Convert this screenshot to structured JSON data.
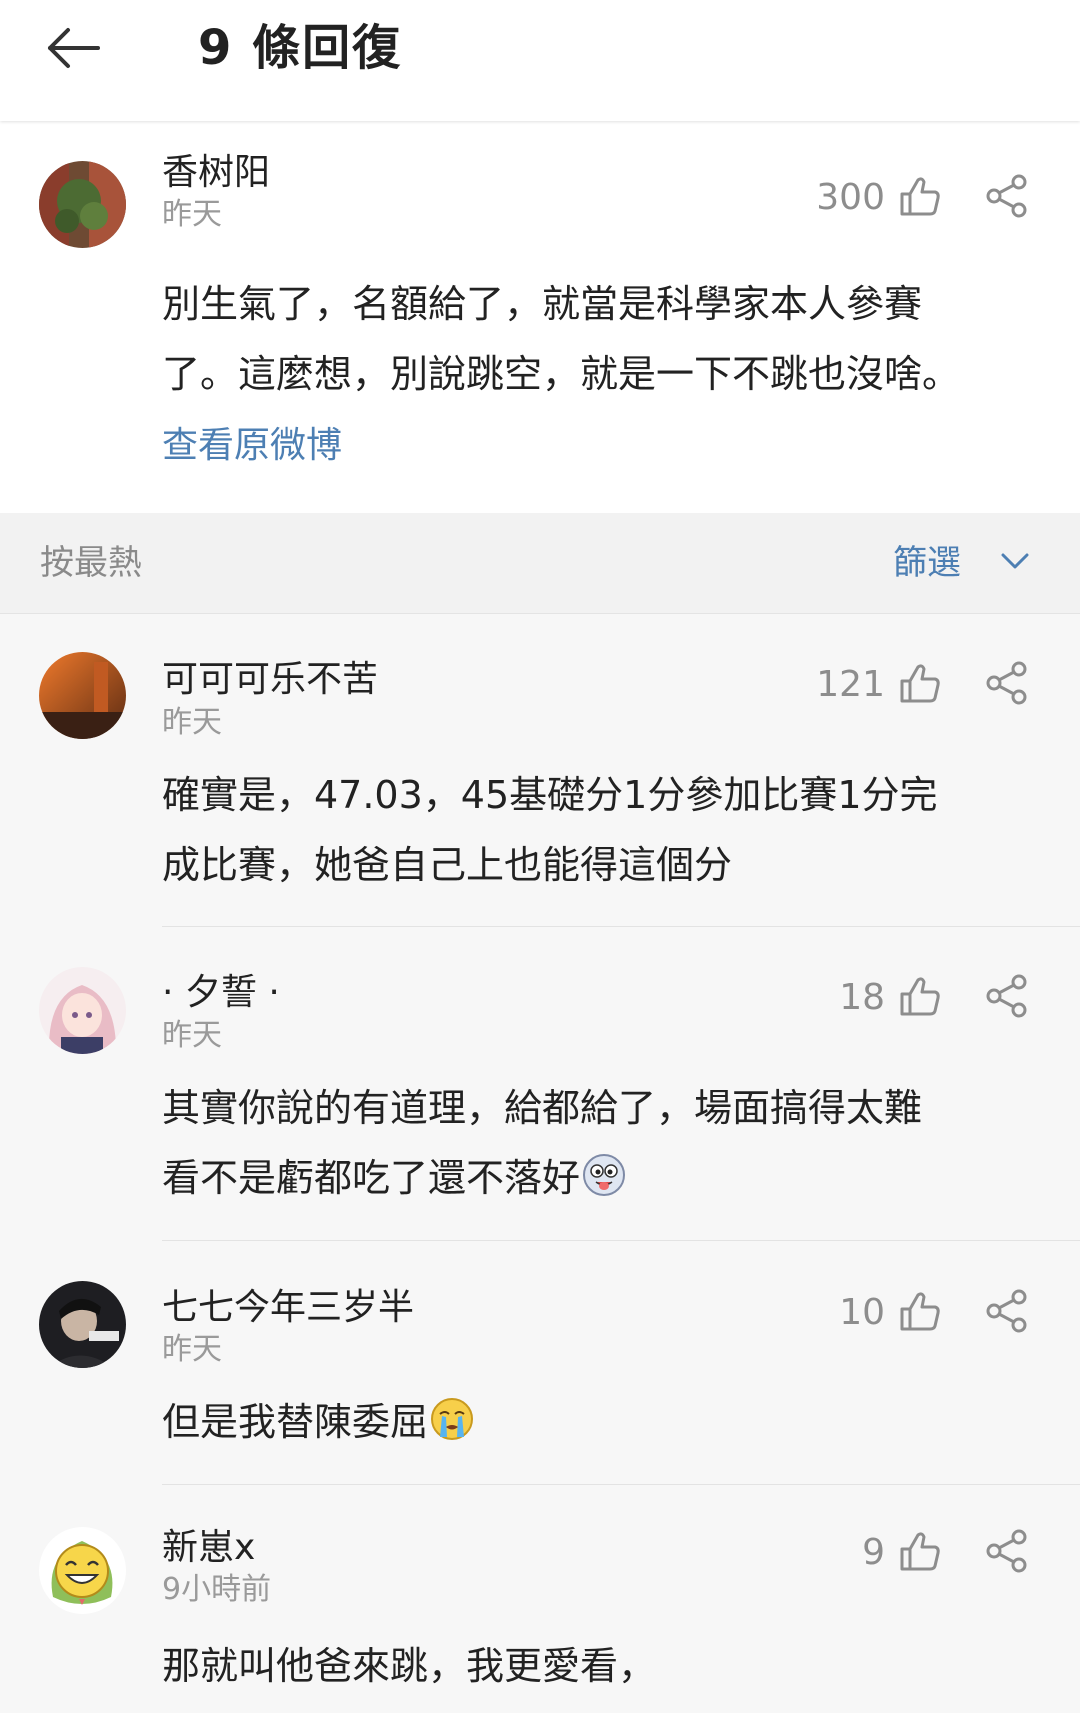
{
  "header": {
    "title": "9 條回復"
  },
  "root_comment": {
    "username": "香树阳",
    "timestamp": "昨天",
    "like_count": "300",
    "text": "別生氣了，名額給了，就當是科學家本人參賽\n了。這麼想，別說跳空，就是一下不跳也沒啥。",
    "view_original": "查看原微博"
  },
  "sort_bar": {
    "sort_label": "按最熱",
    "filter_label": "篩選"
  },
  "replies": [
    {
      "username": "可可可乐不苦",
      "timestamp": "昨天",
      "like_count": "121",
      "text": "確實是，47.03，45基礎分1分參加比賽1分完\n成比賽，她爸自己上也能得這個分"
    },
    {
      "username": "· 夕誓 ·",
      "timestamp": "昨天",
      "like_count": "18",
      "text": "其實你說的有道理，給都給了，場面搞得太難\n看不是虧都吃了還不落好"
    },
    {
      "username": "七七今年三岁半",
      "timestamp": "昨天",
      "like_count": "10",
      "text": "但是我替陳委屈"
    },
    {
      "username": "新崽x",
      "timestamp": "9小時前",
      "like_count": "9",
      "text": "那就叫他爸來跳，我更愛看，"
    }
  ],
  "icons": {
    "back": "arrow-left-icon",
    "like": "thumbs-up-icon",
    "share": "share-icon",
    "filter": "chevron-down-icon"
  },
  "colors": {
    "link": "#4d7fb3",
    "secondary_text": "#9a9a9a",
    "background": "#f7f7f7"
  }
}
